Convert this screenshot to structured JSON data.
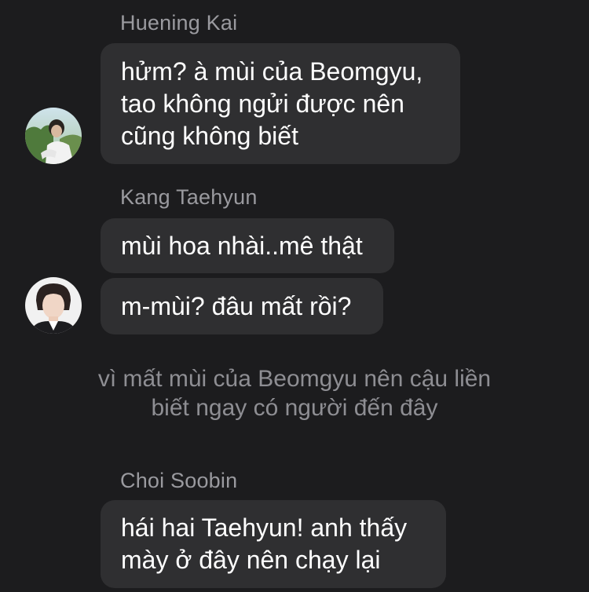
{
  "chat": {
    "group1": {
      "sender": "Huening Kai",
      "messages": [
        {
          "text": "hửm? à mùi của Beomgyu,\ntao không ngửi được nên\ncũng không biết"
        }
      ],
      "avatar_icon": "profile-photo-outdoor"
    },
    "group2": {
      "sender": "Kang Taehyun",
      "messages": [
        {
          "text": "mùi hoa nhài..mê thật"
        },
        {
          "text": "m-mùi? đâu mất rồi?"
        }
      ],
      "avatar_icon": "profile-photo-portrait"
    },
    "system_note": {
      "line1": "vì mất mùi của Beomgyu nên cậu liền",
      "line2": "biết ngay có người đến đây"
    },
    "group3": {
      "sender": "Choi Soobin",
      "messages": [
        {
          "text": "hái hai Taehyun! anh thấy\nmày ở đây nên chạy lại"
        }
      ]
    }
  },
  "colors": {
    "background": "#1c1c1e",
    "bubble": "#2f2f31",
    "sender_name": "#9a9a9f",
    "system_text": "#8e8e93",
    "message_text": "#ffffff"
  }
}
